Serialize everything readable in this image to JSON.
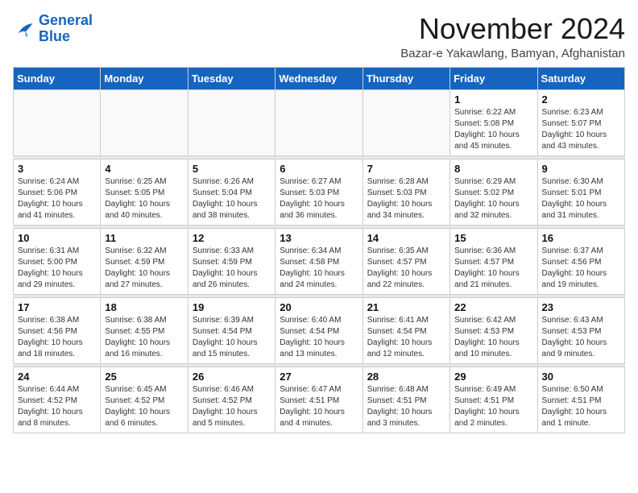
{
  "logo": {
    "text_general": "General",
    "text_blue": "Blue"
  },
  "header": {
    "month_title": "November 2024",
    "location": "Bazar-e Yakawlang, Bamyan, Afghanistan"
  },
  "weekdays": [
    "Sunday",
    "Monday",
    "Tuesday",
    "Wednesday",
    "Thursday",
    "Friday",
    "Saturday"
  ],
  "weeks": [
    [
      {
        "day": "",
        "info": ""
      },
      {
        "day": "",
        "info": ""
      },
      {
        "day": "",
        "info": ""
      },
      {
        "day": "",
        "info": ""
      },
      {
        "day": "",
        "info": ""
      },
      {
        "day": "1",
        "info": "Sunrise: 6:22 AM\nSunset: 5:08 PM\nDaylight: 10 hours and 45 minutes."
      },
      {
        "day": "2",
        "info": "Sunrise: 6:23 AM\nSunset: 5:07 PM\nDaylight: 10 hours and 43 minutes."
      }
    ],
    [
      {
        "day": "3",
        "info": "Sunrise: 6:24 AM\nSunset: 5:06 PM\nDaylight: 10 hours and 41 minutes."
      },
      {
        "day": "4",
        "info": "Sunrise: 6:25 AM\nSunset: 5:05 PM\nDaylight: 10 hours and 40 minutes."
      },
      {
        "day": "5",
        "info": "Sunrise: 6:26 AM\nSunset: 5:04 PM\nDaylight: 10 hours and 38 minutes."
      },
      {
        "day": "6",
        "info": "Sunrise: 6:27 AM\nSunset: 5:03 PM\nDaylight: 10 hours and 36 minutes."
      },
      {
        "day": "7",
        "info": "Sunrise: 6:28 AM\nSunset: 5:03 PM\nDaylight: 10 hours and 34 minutes."
      },
      {
        "day": "8",
        "info": "Sunrise: 6:29 AM\nSunset: 5:02 PM\nDaylight: 10 hours and 32 minutes."
      },
      {
        "day": "9",
        "info": "Sunrise: 6:30 AM\nSunset: 5:01 PM\nDaylight: 10 hours and 31 minutes."
      }
    ],
    [
      {
        "day": "10",
        "info": "Sunrise: 6:31 AM\nSunset: 5:00 PM\nDaylight: 10 hours and 29 minutes."
      },
      {
        "day": "11",
        "info": "Sunrise: 6:32 AM\nSunset: 4:59 PM\nDaylight: 10 hours and 27 minutes."
      },
      {
        "day": "12",
        "info": "Sunrise: 6:33 AM\nSunset: 4:59 PM\nDaylight: 10 hours and 26 minutes."
      },
      {
        "day": "13",
        "info": "Sunrise: 6:34 AM\nSunset: 4:58 PM\nDaylight: 10 hours and 24 minutes."
      },
      {
        "day": "14",
        "info": "Sunrise: 6:35 AM\nSunset: 4:57 PM\nDaylight: 10 hours and 22 minutes."
      },
      {
        "day": "15",
        "info": "Sunrise: 6:36 AM\nSunset: 4:57 PM\nDaylight: 10 hours and 21 minutes."
      },
      {
        "day": "16",
        "info": "Sunrise: 6:37 AM\nSunset: 4:56 PM\nDaylight: 10 hours and 19 minutes."
      }
    ],
    [
      {
        "day": "17",
        "info": "Sunrise: 6:38 AM\nSunset: 4:56 PM\nDaylight: 10 hours and 18 minutes."
      },
      {
        "day": "18",
        "info": "Sunrise: 6:38 AM\nSunset: 4:55 PM\nDaylight: 10 hours and 16 minutes."
      },
      {
        "day": "19",
        "info": "Sunrise: 6:39 AM\nSunset: 4:54 PM\nDaylight: 10 hours and 15 minutes."
      },
      {
        "day": "20",
        "info": "Sunrise: 6:40 AM\nSunset: 4:54 PM\nDaylight: 10 hours and 13 minutes."
      },
      {
        "day": "21",
        "info": "Sunrise: 6:41 AM\nSunset: 4:54 PM\nDaylight: 10 hours and 12 minutes."
      },
      {
        "day": "22",
        "info": "Sunrise: 6:42 AM\nSunset: 4:53 PM\nDaylight: 10 hours and 10 minutes."
      },
      {
        "day": "23",
        "info": "Sunrise: 6:43 AM\nSunset: 4:53 PM\nDaylight: 10 hours and 9 minutes."
      }
    ],
    [
      {
        "day": "24",
        "info": "Sunrise: 6:44 AM\nSunset: 4:52 PM\nDaylight: 10 hours and 8 minutes."
      },
      {
        "day": "25",
        "info": "Sunrise: 6:45 AM\nSunset: 4:52 PM\nDaylight: 10 hours and 6 minutes."
      },
      {
        "day": "26",
        "info": "Sunrise: 6:46 AM\nSunset: 4:52 PM\nDaylight: 10 hours and 5 minutes."
      },
      {
        "day": "27",
        "info": "Sunrise: 6:47 AM\nSunset: 4:51 PM\nDaylight: 10 hours and 4 minutes."
      },
      {
        "day": "28",
        "info": "Sunrise: 6:48 AM\nSunset: 4:51 PM\nDaylight: 10 hours and 3 minutes."
      },
      {
        "day": "29",
        "info": "Sunrise: 6:49 AM\nSunset: 4:51 PM\nDaylight: 10 hours and 2 minutes."
      },
      {
        "day": "30",
        "info": "Sunrise: 6:50 AM\nSunset: 4:51 PM\nDaylight: 10 hours and 1 minute."
      }
    ]
  ]
}
